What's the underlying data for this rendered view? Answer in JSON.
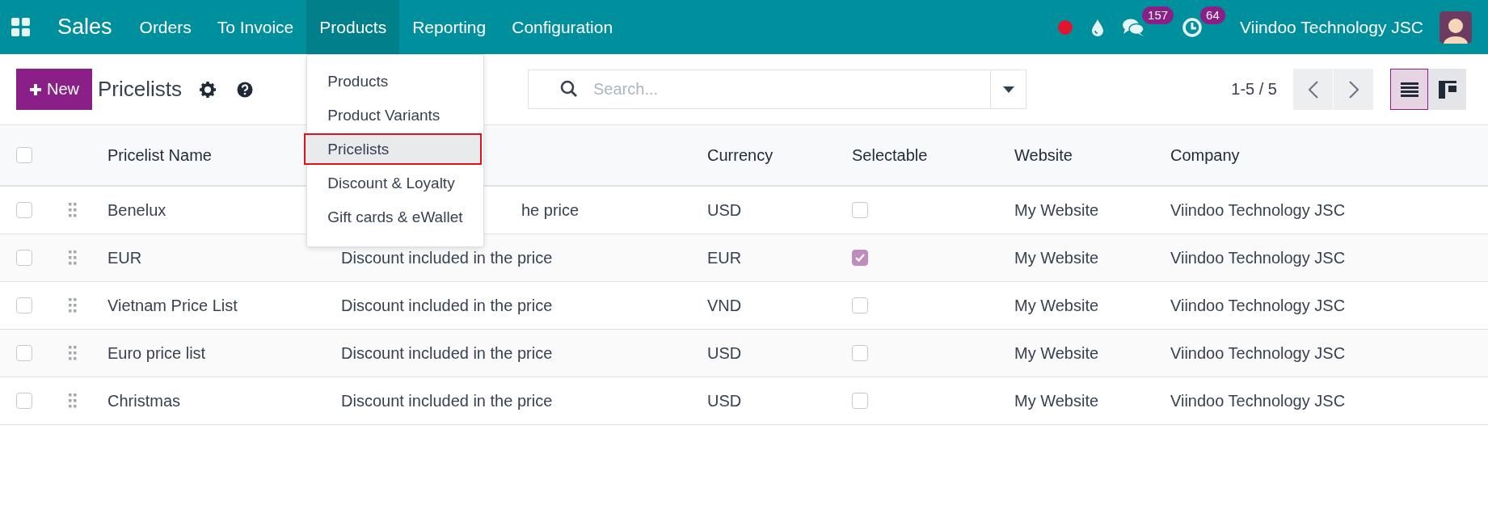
{
  "navbar": {
    "app": "Sales",
    "menus": [
      {
        "label": "Orders",
        "selected": false
      },
      {
        "label": "To Invoice",
        "selected": false
      },
      {
        "label": "Products",
        "selected": true
      },
      {
        "label": "Reporting",
        "selected": false
      },
      {
        "label": "Configuration",
        "selected": false
      }
    ],
    "systray": [
      {
        "kind": "recording"
      },
      {
        "kind": "drop"
      },
      {
        "kind": "chat",
        "badge": "157"
      },
      {
        "kind": "activity",
        "badge": "64"
      }
    ],
    "company": "Viindoo Technology JSC"
  },
  "dropdown": [
    {
      "label": "Products",
      "selected": false
    },
    {
      "label": "Product Variants",
      "selected": false
    },
    {
      "label": "Pricelists",
      "selected": true
    },
    {
      "label": "Discount & Loyalty",
      "selected": false
    },
    {
      "label": "Gift cards & eWallet",
      "selected": false
    }
  ],
  "control_panel": {
    "new_button": "New",
    "title": "Pricelists",
    "search": {
      "placeholder": "Search..."
    },
    "pager": "1-5 / 5",
    "views": [
      {
        "kind": "list",
        "selected": true
      },
      {
        "kind": "kanban",
        "selected": false
      }
    ]
  },
  "table": {
    "all_checked": false,
    "header": {
      "name": "Pricelist Name",
      "currency": "Currency",
      "selectable": "Selectable",
      "website": "Website",
      "company": "Company"
    },
    "rows": [
      {
        "checked": false,
        "name": "Benelux",
        "description": "he price",
        "description_covered": true,
        "currency": "USD",
        "selectable": false,
        "website": "My Website",
        "company": "Viindoo Technology JSC"
      },
      {
        "checked": false,
        "name": "EUR",
        "description": "Discount included in the price",
        "description_covered": false,
        "currency": "EUR",
        "selectable": true,
        "website": "My Website",
        "company": "Viindoo Technology JSC"
      },
      {
        "checked": false,
        "name": "Vietnam Price List",
        "description": "Discount included in the price",
        "description_covered": false,
        "currency": "VND",
        "selectable": false,
        "website": "My Website",
        "company": "Viindoo Technology JSC"
      },
      {
        "checked": false,
        "name": "Euro price list",
        "description": "Discount included in the price",
        "description_covered": false,
        "currency": "USD",
        "selectable": false,
        "website": "My Website",
        "company": "Viindoo Technology JSC"
      },
      {
        "checked": false,
        "name": "Christmas",
        "description": "Discount included in the price",
        "description_covered": false,
        "currency": "USD",
        "selectable": false,
        "website": "My Website",
        "company": "Viindoo Technology JSC"
      }
    ]
  }
}
